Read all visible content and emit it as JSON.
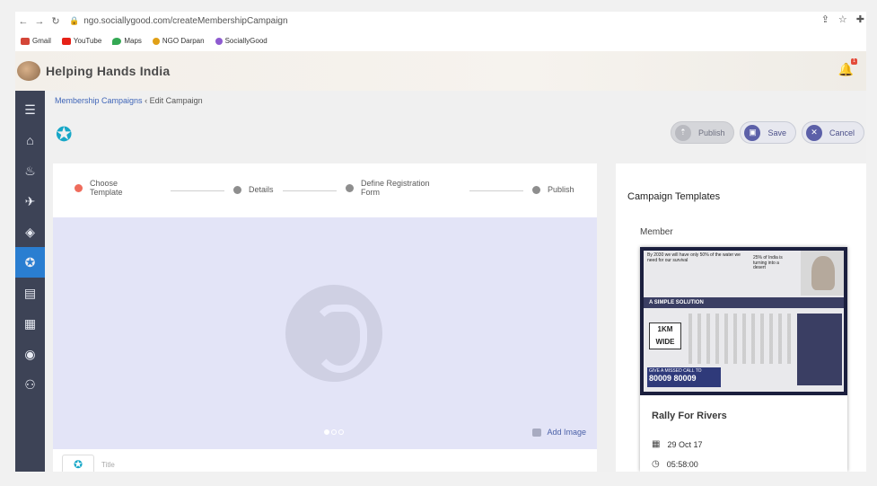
{
  "browser": {
    "url": "ngo.sociallygood.com/createMembershipCampaign",
    "bookmarks": [
      {
        "label": "Gmail",
        "color": "#d44638"
      },
      {
        "label": "YouTube",
        "color": "#e62117"
      },
      {
        "label": "Maps",
        "color": "#34a853"
      },
      {
        "label": "NGO Darpan",
        "color": "#e0a017"
      },
      {
        "label": "SociallyGood",
        "color": "#8e5bd0"
      }
    ]
  },
  "app": {
    "title": "Helping Hands India",
    "notification_count": "1"
  },
  "breadcrumb": {
    "parent": "Membership Campaigns",
    "separator": "‹",
    "current": "Edit Campaign"
  },
  "actions": {
    "publish": "Publish",
    "save": "Save",
    "cancel": "Cancel"
  },
  "steps": [
    {
      "line1": "Choose",
      "line2": "Template",
      "state": "active"
    },
    {
      "line1": "Details",
      "line2": "",
      "state": "pending"
    },
    {
      "line1": "Define Registration",
      "line2": "Form",
      "state": "pending"
    },
    {
      "line1": "Publish",
      "line2": "",
      "state": "pending"
    }
  ],
  "banner": {
    "add_image": "Add Image"
  },
  "title_field": {
    "placeholder": "Title"
  },
  "panel": {
    "title": "Campaign Templates",
    "subtitle": "Member",
    "template": {
      "name": "Rally For Rivers",
      "date": "29 Oct 17",
      "time": "05:58:00",
      "poster": {
        "headline": "By 2030 we will have only 50% of the water we need for our survival",
        "stat": "25% of India is turning into a desert",
        "band": "A SIMPLE SOLUTION",
        "km": "1KM WIDE",
        "call": "GIVE A MISSED CALL TO",
        "phone": "80009 80009"
      }
    }
  },
  "colors": {
    "sidebar": "#3d4356",
    "active": "#2a7ed1",
    "step_active": "#ef6c5c",
    "banner": "#e3e4f7"
  }
}
